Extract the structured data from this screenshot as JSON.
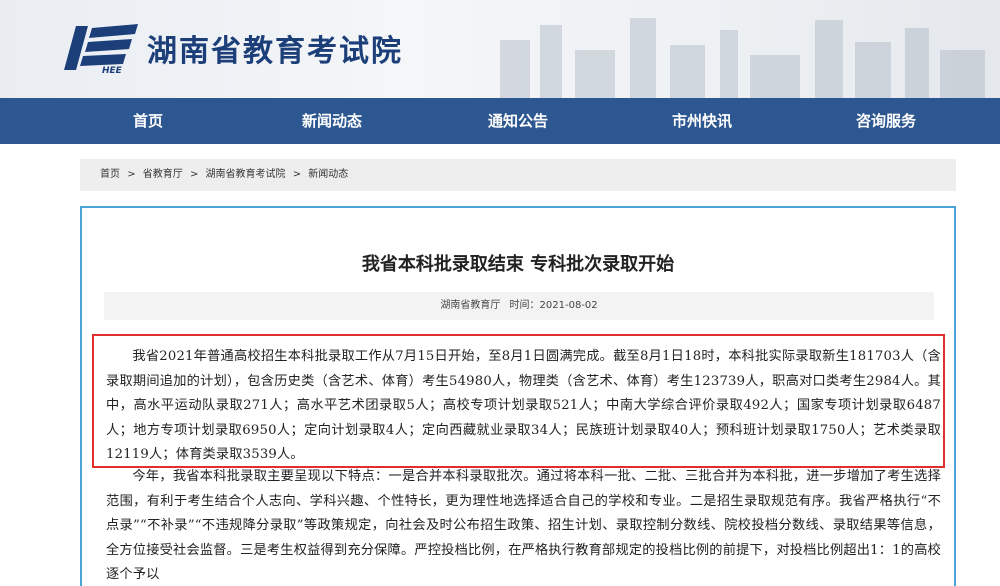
{
  "header": {
    "site_title": "湖南省教育考试院",
    "logo_text": "HEE"
  },
  "nav": {
    "items": [
      "首页",
      "新闻动态",
      "通知公告",
      "市州快讯",
      "咨询服务"
    ]
  },
  "breadcrumb": {
    "items": [
      "首页",
      "省教育厅",
      "湖南省教育考试院",
      "新闻动态"
    ],
    "separator": ">"
  },
  "article": {
    "title": "我省本科批录取结束 专科批次录取开始",
    "source": "湖南省教育厅",
    "time_label": "时间：",
    "date": "2021-08-02",
    "paragraph1": "我省2021年普通高校招生本科批录取工作从7月15日开始，至8月1日圆满完成。截至8月1日18时，本科批实际录取新生181703人（含录取期间追加的计划），包含历史类（含艺术、体育）考生54980人，物理类（含艺术、体育）考生123739人，职高对口类考生2984人。其中，高水平运动队录取271人；高水平艺术团录取5人；高校专项计划录取521人；中南大学综合评价录取492人；国家专项计划录取6487人；地方专项计划录取6950人；定向计划录取4人；定向西藏就业录取34人；民族班计划录取40人；预科班计划录取1750人；艺术类录取12119人；体育类录取3539人。",
    "paragraph2": "今年，我省本科批录取主要呈现以下特点：一是合并本科录取批次。通过将本科一批、二批、三批合并为本科批，进一步增加了考生选择范围，有利于考生结合个人志向、学科兴趣、个性特长，更为理性地选择适合自己的学校和专业。二是招生录取规范有序。我省严格执行“不点录”“不补录”“不违规降分录取”等政策规定，向社会及时公布招生政策、招生计划、录取控制分数线、院校投档分数线、录取结果等信息，全方位接受社会监督。三是考生权益得到充分保障。严控投档比例，在严格执行教育部规定的投档比例的前提下，对投档比例超出1：1的高校逐个予以"
  },
  "colors": {
    "nav_bg": "#2d5791",
    "title_blue": "#1c3f7a",
    "box_border": "#4aa3d8",
    "highlight_border": "#e0302e"
  }
}
